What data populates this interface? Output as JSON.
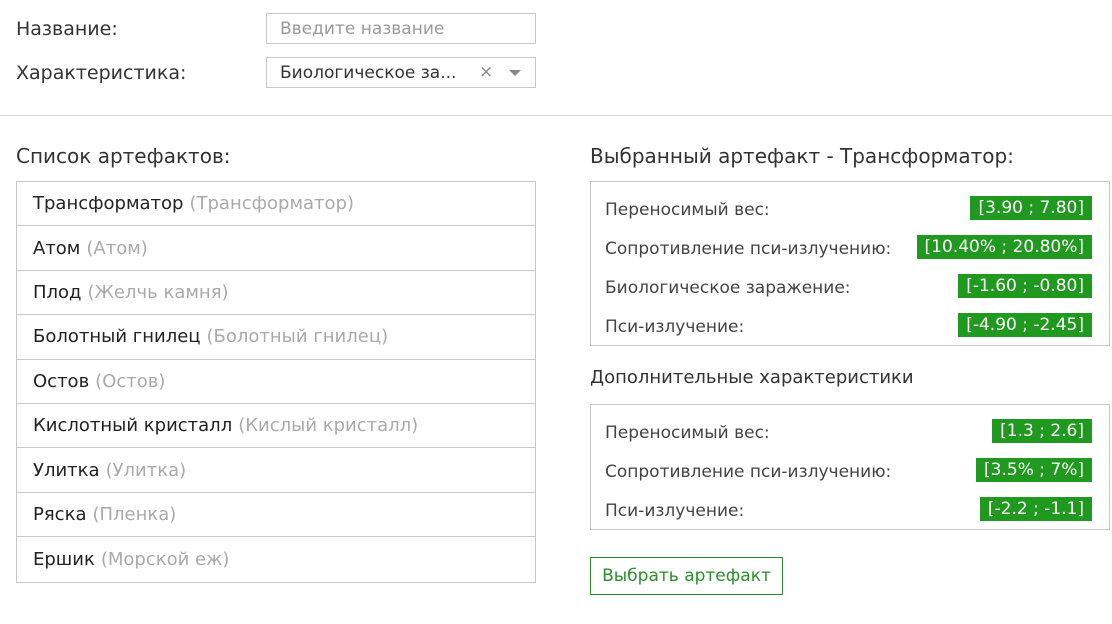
{
  "filters": {
    "name_label": "Название:",
    "name_placeholder": "Введите название",
    "name_value": "",
    "char_label": "Характеристика:",
    "char_value": "Биологическое за...",
    "char_clear": "×"
  },
  "list": {
    "title": "Список артефактов:",
    "items": [
      {
        "name": "Трансформатор",
        "alt": "(Трансформатор)"
      },
      {
        "name": "Атом",
        "alt": "(Атом)"
      },
      {
        "name": "Плод",
        "alt": "(Желчь камня)"
      },
      {
        "name": "Болотный гнилец",
        "alt": "(Болотный гнилец)"
      },
      {
        "name": "Остов",
        "alt": "(Остов)"
      },
      {
        "name": "Кислотный кристалл",
        "alt": "(Кислый кристалл)"
      },
      {
        "name": "Улитка",
        "alt": "(Улитка)"
      },
      {
        "name": "Ряска",
        "alt": "(Пленка)"
      },
      {
        "name": "Ершик",
        "alt": "(Морской еж)"
      }
    ]
  },
  "selected": {
    "title": "Выбранный артефакт - Трансформатор:",
    "stats": [
      {
        "label": "Переносимый вес:",
        "value": "[3.90 ; 7.80]"
      },
      {
        "label": "Сопротивление пси-излучению:",
        "value": "[10.40% ; 20.80%]"
      },
      {
        "label": "Биологическое заражение:",
        "value": "[-1.60 ; -0.80]"
      },
      {
        "label": "Пси-излучение:",
        "value": "[-4.90 ; -2.45]"
      }
    ]
  },
  "extra": {
    "title": "Дополнительные характеристики",
    "stats": [
      {
        "label": "Переносимый вес:",
        "value": "[1.3 ; 2.6]"
      },
      {
        "label": "Сопротивление пси-излучению:",
        "value": "[3.5% ; 7%]"
      },
      {
        "label": "Пси-излучение:",
        "value": "[-2.2 ; -1.1]"
      }
    ]
  },
  "actions": {
    "select_button": "Выбрать артефакт"
  },
  "colors": {
    "accent": "#1f9a1f",
    "button_border": "#2a8f2a"
  }
}
